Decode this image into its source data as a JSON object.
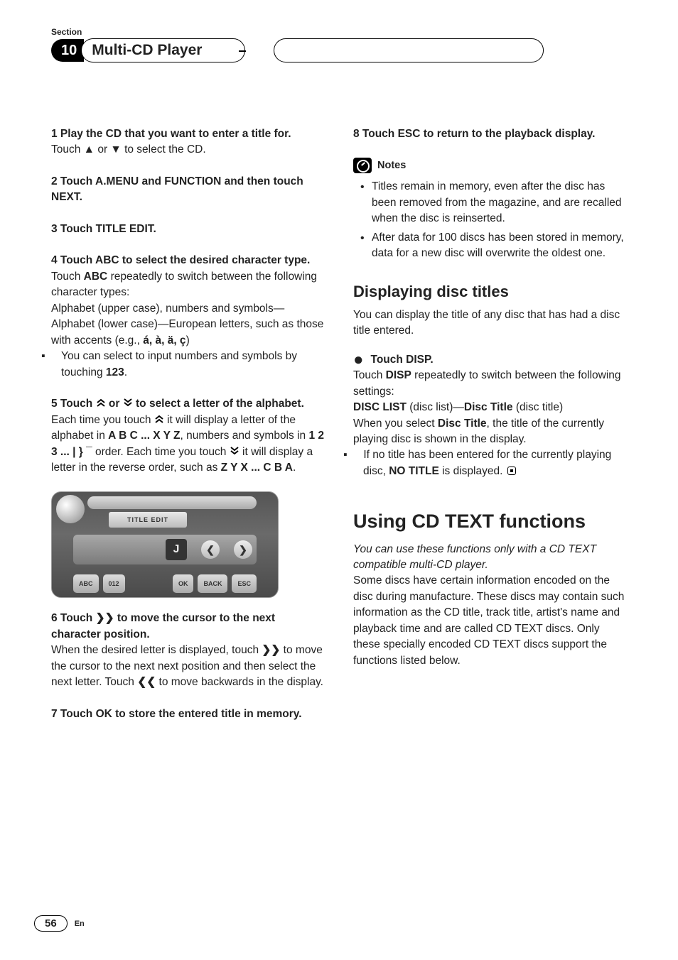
{
  "header": {
    "section_label": "Section",
    "section_number": "10",
    "chapter_title": "Multi-CD Player"
  },
  "left": {
    "step1": {
      "head": "1   Play the CD that you want to enter a title for.",
      "body_pre": "Touch ",
      "body_mid": " or ",
      "body_post": " to select the CD."
    },
    "step2": {
      "head": "2   Touch A.MENU and FUNCTION and then touch NEXT."
    },
    "step3": {
      "head": "3   Touch TITLE EDIT."
    },
    "step4": {
      "head": "4   Touch ABC to select the desired character type.",
      "l1a": "Touch ",
      "l1b": "ABC",
      "l1c": " repeatedly to switch between the following character types:",
      "l2": "Alphabet (upper case), numbers and symbols—Alphabet (lower case)—European letters, such as those with accents (e.g., ",
      "l2b": "á, à, ä, ç",
      "l2c": ")",
      "bullet_a": "You can select to input numbers and symbols by touching ",
      "bullet_b": "123",
      "bullet_c": "."
    },
    "step5": {
      "head_a": "5   Touch ",
      "head_b": " or ",
      "head_c": " to select a letter of the alphabet.",
      "b1a": "Each time you touch ",
      "b1b": " it will display a letter of the alphabet in ",
      "b1c": "A B C ... X Y Z",
      "b1d": ", numbers and symbols in ",
      "b1e": "1 2 3 ... | } ¯",
      "b1f": " order. Each time you touch ",
      "b1g": " it will display a letter in the reverse order, such as ",
      "b1h": "Z Y X ... C B A",
      "b1i": "."
    },
    "device": {
      "tag": "TITLE EDIT",
      "letter": "J",
      "abc": "ABC",
      "num": "012",
      "ok": "OK",
      "back": "BACK",
      "esc": "ESC"
    },
    "step6": {
      "head_a": "6   Touch ",
      "head_b": " to move the cursor to the next character position.",
      "b1a": "When the desired letter is displayed, touch ",
      "b1b": " to move the cursor to the next next position and then select the next letter. Touch ",
      "b1c": " to move backwards in the display."
    },
    "step7": {
      "head": "7   Touch OK to store the entered title in memory."
    }
  },
  "right": {
    "step8": {
      "head": "8   Touch ESC to return to the playback display."
    },
    "notes_label": "Notes",
    "notes": [
      "Titles remain in memory, even after the disc has been removed from the magazine, and are recalled when the disc is reinserted.",
      "After data for 100 discs has been stored in memory, data for a new disc will overwrite the oldest one."
    ],
    "disp_title": "Displaying disc titles",
    "disp_intro": "You can display the title of any disc that has had a disc title entered.",
    "disp_step_head": "Touch DISP.",
    "disp_l1a": "Touch ",
    "disp_l1b": "DISP",
    "disp_l1c": " repeatedly to switch between the following settings:",
    "disp_l2a": "DISC LIST",
    "disp_l2b": " (disc list)—",
    "disp_l2c": "Disc Title",
    "disp_l2d": " (disc title)",
    "disp_l3a": "When you select ",
    "disp_l3b": "Disc Title",
    "disp_l3c": ", the title of the currently playing disc is shown in the display.",
    "disp_bullet_a": "If no title has been entered for the currently playing disc, ",
    "disp_bullet_b": "NO TITLE",
    "disp_bullet_c": " is displayed.",
    "cdtext_title": "Using CD TEXT functions",
    "cdtext_ital": "You can use these functions only with a CD TEXT compatible multi-CD player.",
    "cdtext_body": "Some discs have certain information encoded on the disc during manufacture. These discs may contain such information as the CD title, track title, artist's name and playback time and are called CD TEXT discs. Only these specially encoded CD TEXT discs support the functions listed below."
  },
  "footer": {
    "page": "56",
    "lang": "En"
  },
  "glyphs": {
    "up": "▲",
    "down": "▼",
    "dbl_up": "❢",
    "dbl_down": "❣",
    "fwd": "❱❱",
    "back": "❰❰"
  }
}
